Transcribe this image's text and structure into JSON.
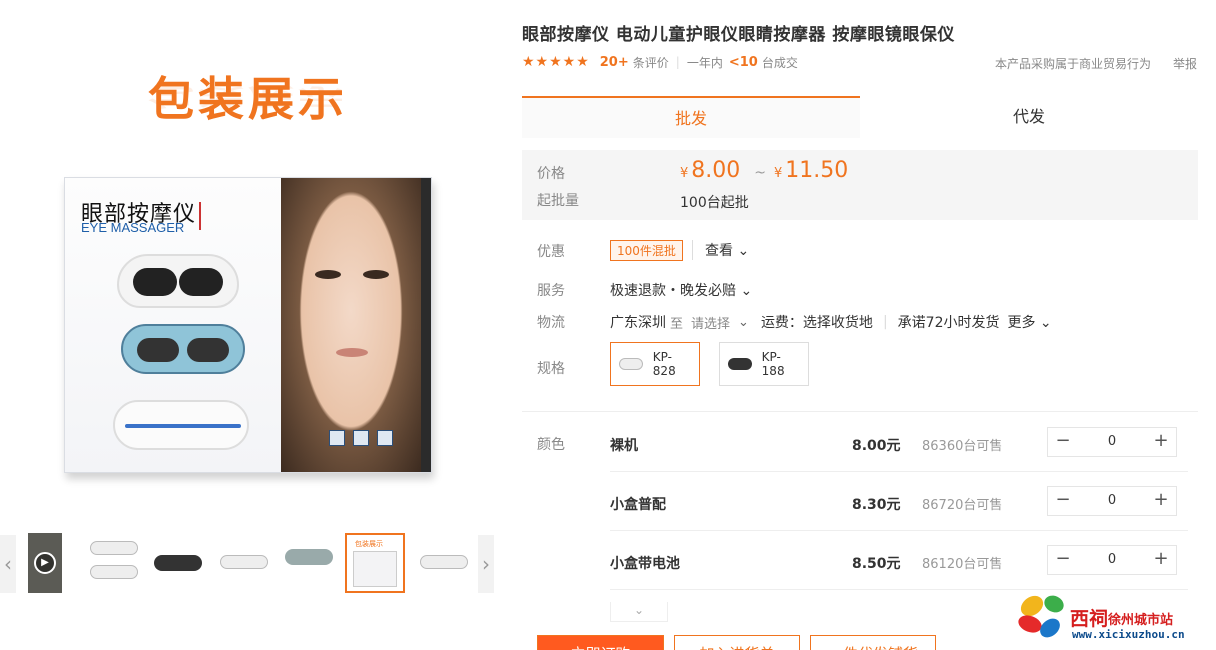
{
  "gallery": {
    "pack_title": "包装展示",
    "box_title_cn": "眼部按摩仪",
    "box_title_en": "EYE MASSAGER",
    "prev_arrow": "‹",
    "next_arrow": "›",
    "play_icon": "▶",
    "thumb_count": 7,
    "active_thumb": 5,
    "thumb_pack_label": "包装展示"
  },
  "product": {
    "title": "眼部按摩仪 电动儿童护眼仪眼睛按摩器 按摩眼镜眼保仪",
    "stars": "★★★★★",
    "review_count": "20+",
    "review_label": "条评价",
    "year_label": "一年内",
    "deal_count": "<10",
    "deal_label": "台成交",
    "compliance": "本产品采购属于商业贸易行为",
    "report": "举报"
  },
  "tabs": [
    {
      "label": "批发",
      "active": true
    },
    {
      "label": "代发",
      "active": false
    }
  ],
  "pricing": {
    "price_label": "价格",
    "currency": "¥",
    "price_low": "8.00",
    "tilde": "~",
    "price_high": "11.50",
    "moq_label": "起批量",
    "moq_value": "100台起批"
  },
  "info": {
    "discount_label": "优惠",
    "coupon": "100件混批",
    "check": "查看 ⌄",
    "service_label": "服务",
    "service_value": "极速退款・晚发必赔 ⌄",
    "logistics_label": "物流",
    "origin": "广东深圳",
    "to": "至",
    "choose": "请选择",
    "chevron": "⌄",
    "freight": "运费：选择收货地",
    "promise": "承诺72小时发货",
    "more": "更多 ⌄",
    "spec_label": "规格",
    "specs": [
      {
        "name": "KP-828",
        "active": true
      },
      {
        "name": "KP-188",
        "active": false
      }
    ]
  },
  "variants": {
    "label": "颜色",
    "rows": [
      {
        "name": "裸机",
        "price": "8.00元",
        "stock": "86360台可售",
        "qty": "0"
      },
      {
        "name": "小盒普配",
        "price": "8.30元",
        "stock": "86720台可售",
        "qty": "0"
      },
      {
        "name": "小盒带电池",
        "price": "8.50元",
        "stock": "86120台可售",
        "qty": "0"
      }
    ],
    "minus": "−",
    "plus": "+",
    "more_chevron": "⌄"
  },
  "actions": [
    "立即订购",
    "加入进货单",
    "一件代发铺货"
  ],
  "watermark": {
    "main": "西祠",
    "city": "徐州城市站",
    "url": "www.xicixuzhou.cn"
  },
  "colors": {
    "accent": "#f0741f",
    "primary_button": "#ff5a1f"
  }
}
